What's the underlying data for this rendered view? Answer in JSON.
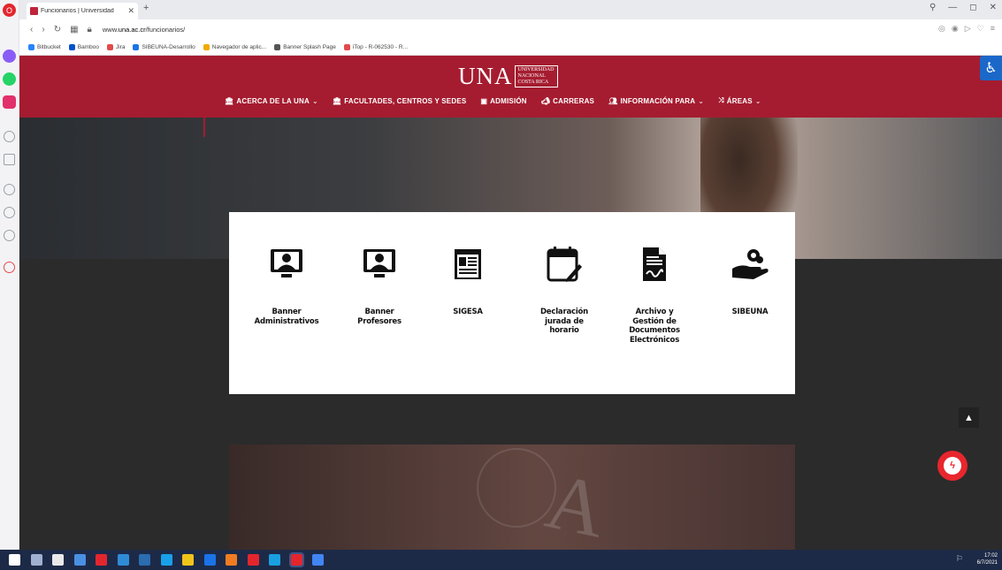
{
  "browser": {
    "tab_title": "Funcionarios | Universidad",
    "new_tab": "+",
    "url_prefix": "www.",
    "url_host": "una.ac.cr",
    "url_path": "/funcionarios/",
    "bookmarks": [
      {
        "label": "Bitbucket",
        "color": "#2684ff"
      },
      {
        "label": "Bamboo",
        "color": "#0052cc"
      },
      {
        "label": "Jira",
        "color": "#e34a4a"
      },
      {
        "label": "SIBEUNA-Desarrollo",
        "color": "#1a73e8"
      },
      {
        "label": "Navegador de aplic...",
        "color": "#f2a900"
      },
      {
        "label": "Banner Splash Page",
        "color": "#555555"
      },
      {
        "label": "iTop - R-062530 - R...",
        "color": "#e34a4a"
      }
    ]
  },
  "site": {
    "logo_text": "UNA",
    "logo_side": [
      "UNIVERSIDAD",
      "NACIONAL",
      "COSTA RICA"
    ],
    "brand_color": "#a51c30",
    "menu": [
      {
        "label": "ACERCA DE LA UNA",
        "icon": "institution-icon",
        "dropdown": true
      },
      {
        "label": "FACULTADES, CENTROS Y SEDES",
        "icon": "institution-icon",
        "dropdown": false
      },
      {
        "label": "ADMISIÓN",
        "icon": "id-card-icon",
        "dropdown": false
      },
      {
        "label": "CARRERAS",
        "icon": "megaphone-icon",
        "dropdown": false
      },
      {
        "label": "INFORMACIÓN PARA",
        "icon": "users-icon",
        "dropdown": true
      },
      {
        "label": "ÁREAS",
        "icon": "shuffle-icon",
        "dropdown": true
      }
    ]
  },
  "services": [
    {
      "label": "Banner\nAdministrativos",
      "icon": "monitor-user-icon"
    },
    {
      "label": "Banner\nProfesores",
      "icon": "monitor-user-icon"
    },
    {
      "label": "SIGESA",
      "icon": "newspaper-icon"
    },
    {
      "label": "Declaración\njurada de\nhorario",
      "icon": "calendar-edit-icon"
    },
    {
      "label": "Archivo y\nGestión de\nDocumentos\nElectrónicos",
      "icon": "signed-document-icon"
    },
    {
      "label": "SIBEUNA",
      "icon": "hand-coin-icon"
    }
  ],
  "taskbar": {
    "time": "17:02",
    "date": "6/7/2021"
  }
}
